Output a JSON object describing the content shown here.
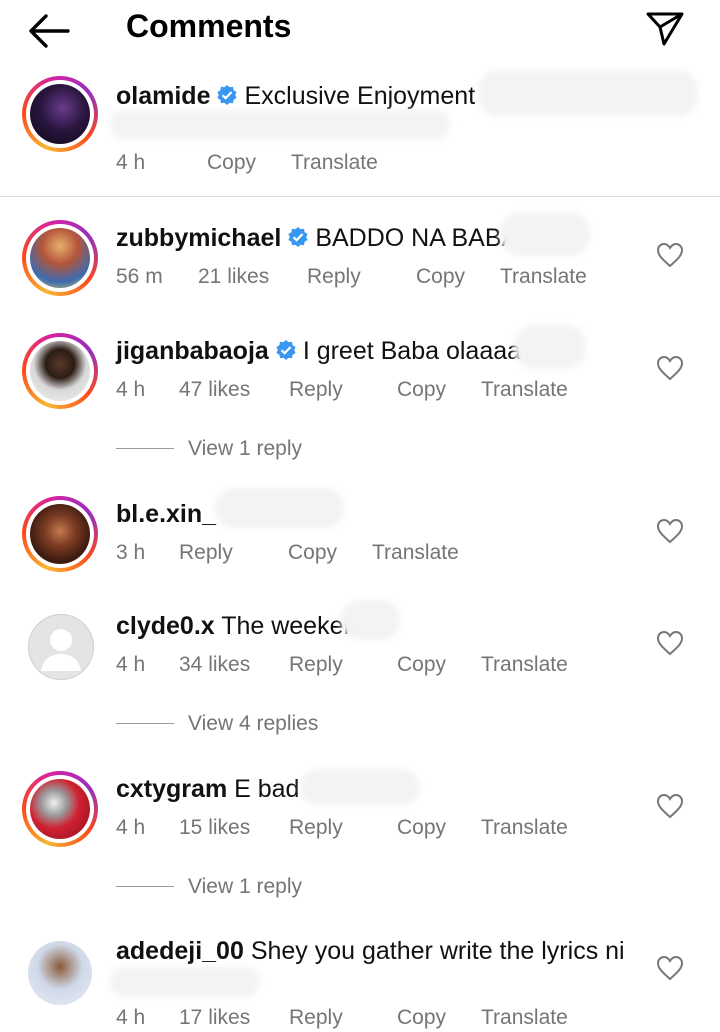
{
  "header": {
    "title": "Comments"
  },
  "caption": {
    "username": "olamide",
    "verified": true,
    "text": "Exclusive Enjoyment",
    "time": "4 h",
    "copy": "Copy",
    "translate": "Translate"
  },
  "comments": [
    {
      "username": "zubbymichael",
      "verified": true,
      "text": "BADDO NA BABA",
      "time": "56 m",
      "likes": "21 likes",
      "reply": "Reply",
      "copy": "Copy",
      "translate": "Translate"
    },
    {
      "username": "jiganbabaoja",
      "verified": true,
      "text": "I greet Baba olaaaa",
      "time": "4 h",
      "likes": "47 likes",
      "reply": "Reply",
      "copy": "Copy",
      "translate": "Translate",
      "view_replies": "View 1 reply"
    },
    {
      "username": "bl.e.xin_",
      "verified": false,
      "text": "",
      "time": "3 h",
      "likes": "",
      "reply": "Reply",
      "copy": "Copy",
      "translate": "Translate"
    },
    {
      "username": "clyde0.x",
      "verified": false,
      "text": "The weekend",
      "time": "4 h",
      "likes": "34 likes",
      "reply": "Reply",
      "copy": "Copy",
      "translate": "Translate",
      "view_replies": "View 4 replies"
    },
    {
      "username": "cxtygram",
      "verified": false,
      "text": "E bad",
      "time": "4 h",
      "likes": "15 likes",
      "reply": "Reply",
      "copy": "Copy",
      "translate": "Translate",
      "view_replies": "View 1 reply"
    },
    {
      "username": "adedeji_00",
      "verified": false,
      "text": "Shey you gather write the lyrics ni",
      "time": "4 h",
      "likes": "17 likes",
      "reply": "Reply",
      "copy": "Copy",
      "translate": "Translate"
    }
  ],
  "icons": {
    "back": "arrow-left-icon",
    "send": "paper-plane-icon",
    "verified": "verified-badge-icon",
    "like": "heart-outline-icon"
  },
  "colors": {
    "verified": "#3897f0",
    "meta": "#757575",
    "divider": "#dcdcdc"
  }
}
